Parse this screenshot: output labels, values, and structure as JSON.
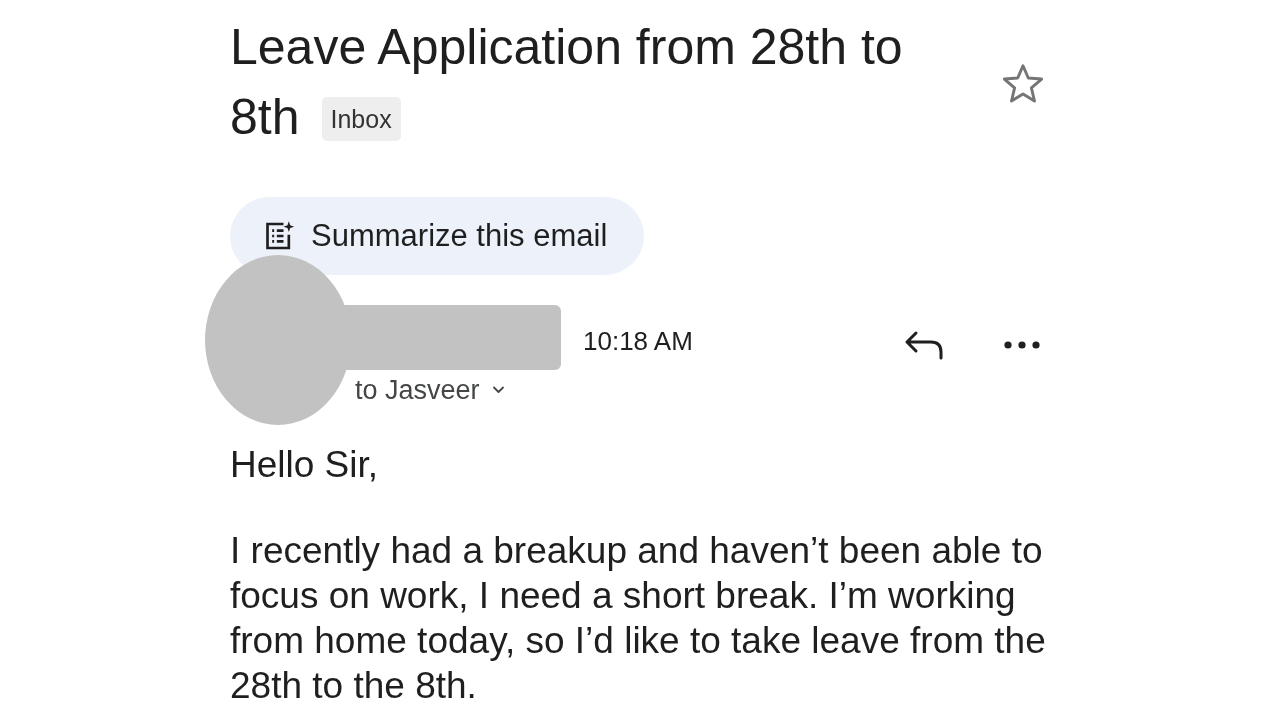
{
  "subject": {
    "title_lines": [
      "Leave Application from 28th to",
      "8th"
    ],
    "label": "Inbox",
    "starred": false
  },
  "summarize_button": {
    "label": "Summarize this email"
  },
  "message": {
    "time": "10:18 AM",
    "recipients": "to Jasveer",
    "greeting": "Hello Sir,",
    "body": "I recently had a breakup and haven’t been able to focus on work, I need a short break. I’m working from home today, so I’d like to take leave from the 28th to the 8th."
  }
}
